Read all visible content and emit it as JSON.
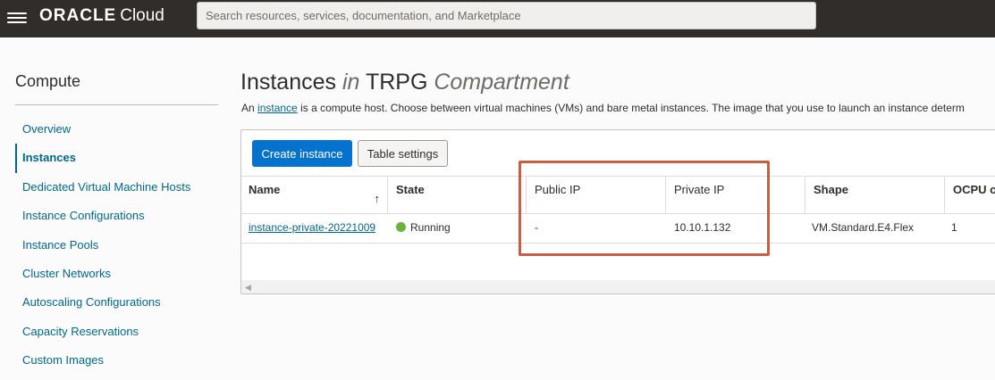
{
  "header": {
    "brand": "ORACLE",
    "product": "Cloud",
    "search_placeholder": "Search resources, services, documentation, and Marketplace"
  },
  "sidebar": {
    "title": "Compute",
    "items": [
      {
        "label": "Overview"
      },
      {
        "label": "Instances",
        "active": true
      },
      {
        "label": "Dedicated Virtual Machine Hosts"
      },
      {
        "label": "Instance Configurations"
      },
      {
        "label": "Instance Pools"
      },
      {
        "label": "Cluster Networks"
      },
      {
        "label": "Autoscaling Configurations"
      },
      {
        "label": "Capacity Reservations"
      },
      {
        "label": "Custom Images"
      }
    ]
  },
  "main": {
    "title_main": "Instances",
    "title_in": "in",
    "title_compartment_name": "TRPG",
    "title_compartment_word": "Compartment",
    "desc_prefix": "An",
    "desc_link": "instance",
    "desc_suffix": "is a compute host. Choose between virtual machines (VMs) and bare metal instances. The image that you use to launch an instance determ",
    "create_button": "Create instance",
    "table_settings_button": "Table settings",
    "columns": [
      "Name",
      "State",
      "Public IP",
      "Private IP",
      "Shape",
      "OCPU co"
    ],
    "sort_arrow": "↑",
    "rows": [
      {
        "name": "instance-private-20221009",
        "state": "Running",
        "public_ip": "-",
        "private_ip": "10.10.1.132",
        "shape": "VM.Standard.E4.Flex",
        "ocpu": "1"
      }
    ],
    "scroll_left": "◀"
  },
  "colors": {
    "topbar": "#312d2a",
    "link": "#00688c",
    "primary_button": "#0572ce",
    "running_dot": "#6cb33e",
    "highlight_box": "#c95f41"
  }
}
